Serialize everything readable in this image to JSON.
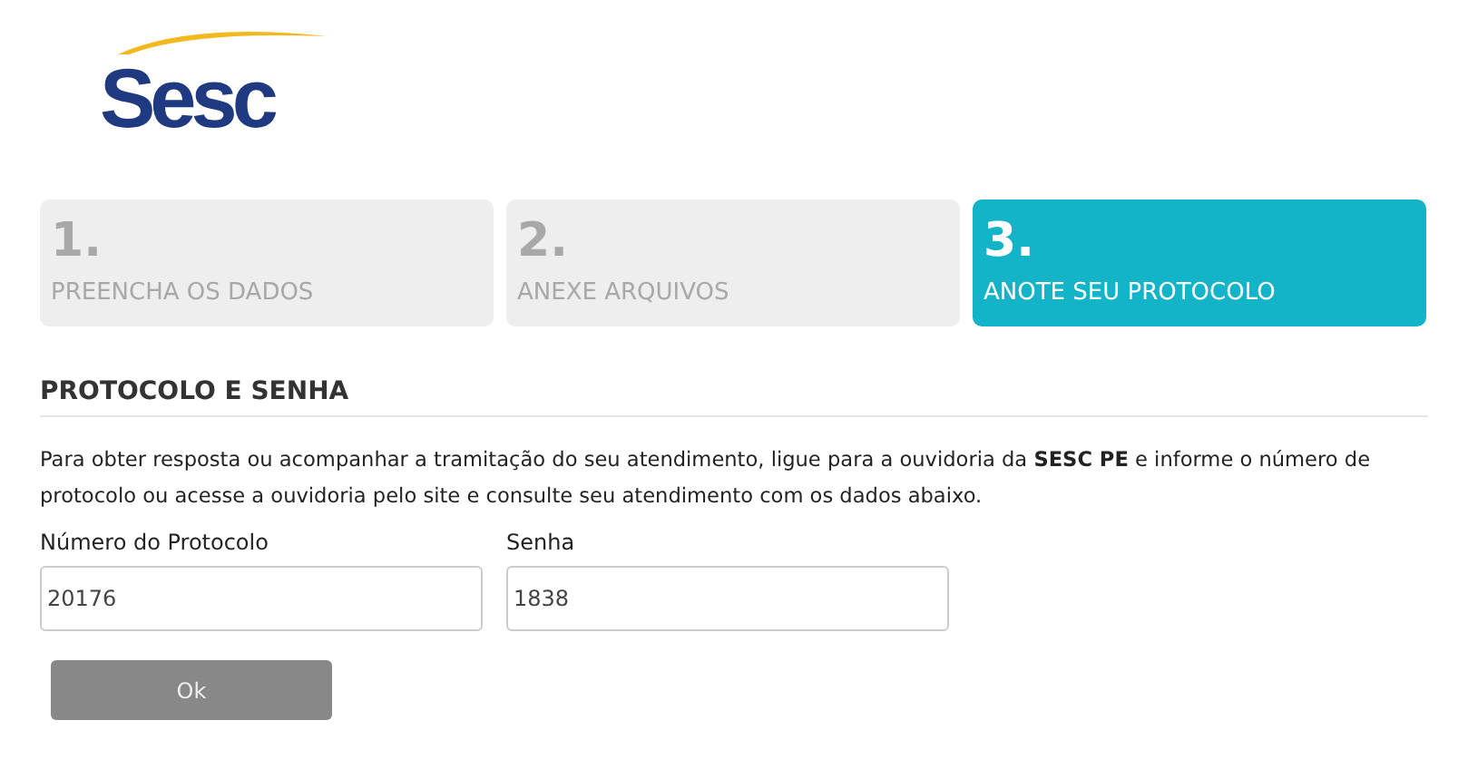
{
  "logo": {
    "text": "Sesc"
  },
  "steps": [
    {
      "number": "1.",
      "label": "PREENCHA OS DADOS",
      "selected": false
    },
    {
      "number": "2.",
      "label": "ANEXE ARQUIVOS",
      "selected": false
    },
    {
      "number": "3.",
      "label": "ANOTE SEU PROTOCOLO",
      "selected": true
    }
  ],
  "section": {
    "title": "PROTOCOLO E SENHA",
    "text": "Para obter resposta ou acompanhar a tramitação do seu atendimento, ligue para a ouvidoria da **SESC PE** e informe o número de protocolo ou acesse a ouvidoria pelo site e consulte seu atendimento com os dados abaixo."
  },
  "fields": [
    {
      "label": "Número do Protocolo",
      "value": "20176"
    },
    {
      "label": "Senha",
      "value": "1838"
    }
  ],
  "button": {
    "label": "Ok"
  }
}
